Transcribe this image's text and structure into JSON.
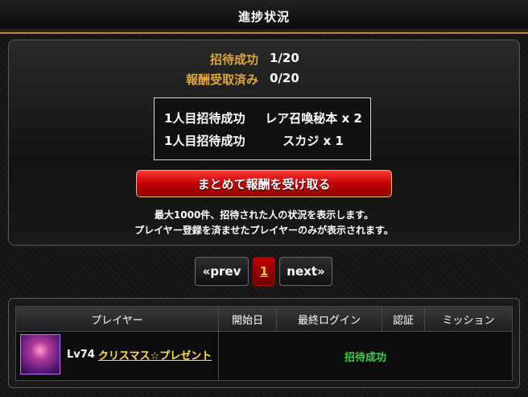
{
  "header": {
    "title": "進捗状況"
  },
  "progress": {
    "invite_label": "招待成功",
    "invite_value": "1/20",
    "reward_label": "報酬受取済み",
    "reward_value": "0/20"
  },
  "rewards": [
    {
      "condition": "1人目招待成功",
      "item": "レア召喚秘本 x 2"
    },
    {
      "condition": "1人目招待成功",
      "item": "スカジ x 1"
    }
  ],
  "receive_button": {
    "label": "まとめて報酬を受け取る"
  },
  "notes": {
    "line1": "最大1000件、招待された人の状況を表示します。",
    "line2": "プレイヤー登録を済ませたプレイヤーのみが表示されます。"
  },
  "pagination": {
    "prev": "«prev",
    "current": "1",
    "next": "next»"
  },
  "table": {
    "headers": [
      "プレイヤー",
      "開始日",
      "最終ログイン",
      "認証",
      "ミッション"
    ],
    "rows": [
      {
        "level": "Lv74",
        "name": "クリスマス☆プレゼント",
        "status": "招待成功"
      }
    ]
  },
  "colors": {
    "accent_gold": "#e0a53a",
    "status_green": "#3bd14a",
    "button_red": "#c40000",
    "link_yellow": "#ffe14a"
  }
}
